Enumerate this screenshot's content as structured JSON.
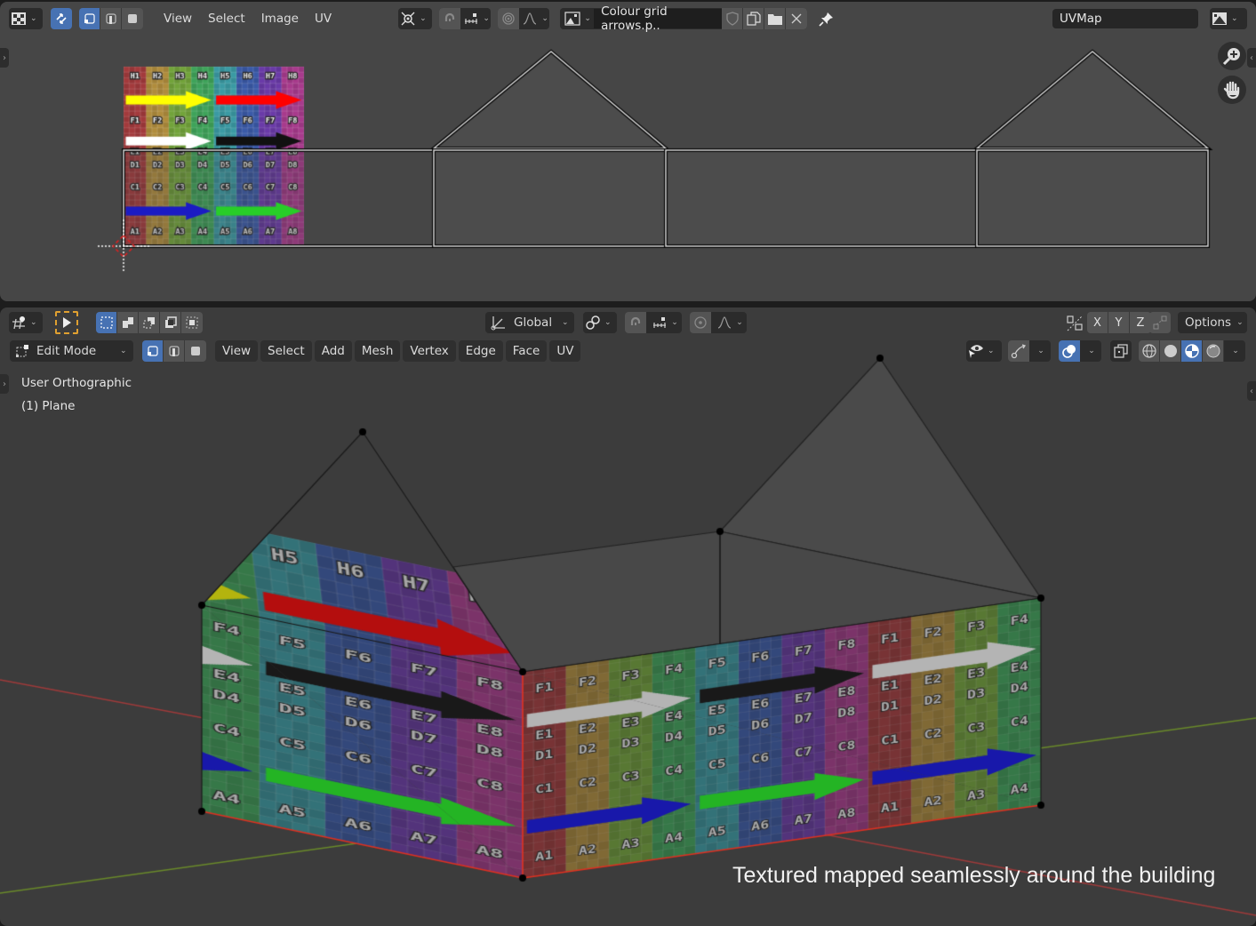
{
  "uv_editor": {
    "header": {
      "editor_type_icon": "uv-image-editor-icon",
      "sync_selection_icon": "uv-sync-selection-icon",
      "select_modes": [
        "vertex-select-icon",
        "edge-select-icon",
        "face-select-icon"
      ],
      "menus": [
        "View",
        "Select",
        "Image",
        "UV"
      ],
      "pivot_icon": "pivot-point-icon",
      "snap_icon": "snap-magnet-icon",
      "snap_increment_icon": "snap-increment-icon",
      "proportional_icon": "proportional-edit-icon",
      "falloff_icon": "falloff-curve-icon",
      "image_browse_icon": "image-browse-icon",
      "image_name": "Colour grid arrows.p..",
      "fake_user_icon": "shield-icon",
      "new_image_icon": "duplicate-icon",
      "open_image_icon": "folder-icon",
      "unlink_icon": "close-icon",
      "pin_icon": "pin-icon",
      "uv_map": "UVMap",
      "display_mode_icon": "image-display-icon"
    },
    "nav": {
      "zoom_icon": "zoom-in-icon",
      "pan_icon": "hand-pan-icon"
    },
    "texture": {
      "rows": [
        "H",
        "G",
        "F",
        "E",
        "D",
        "C",
        "B",
        "A"
      ],
      "columns": [
        "1",
        "2",
        "3",
        "4",
        "5",
        "6",
        "7",
        "8"
      ],
      "column_colors": [
        "#a33a3c",
        "#b08c3c",
        "#72a33a",
        "#3ea35a",
        "#3a9aa3",
        "#3a5aa8",
        "#6a3aa8",
        "#a83a8c"
      ],
      "arrows": [
        {
          "row": "G",
          "half": "left",
          "color": "#ffff00"
        },
        {
          "row": "G",
          "half": "right",
          "color": "#ff0000"
        },
        {
          "row": "E",
          "half": "left",
          "color": "#ffffff"
        },
        {
          "row": "E",
          "half": "right",
          "color": "#111111"
        },
        {
          "row": "B",
          "half": "left",
          "color": "#1010f0"
        },
        {
          "row": "B",
          "half": "right",
          "color": "#22ff22"
        }
      ]
    }
  },
  "viewport": {
    "tool_header": {
      "tool_settings_icon": "transform-tool-icon",
      "active_tool_icon": "select-cursor-icon",
      "select_mode_icons": [
        "select-new-icon",
        "select-extend-icon",
        "select-subtract-icon",
        "select-invert-icon",
        "select-intersect-icon"
      ],
      "orientation": "Global",
      "orientation_icon": "transform-orientation-icon",
      "pivot_icon": "pivot-link-icon",
      "snap_icon": "snap-magnet-icon",
      "snap_increment_icon": "snap-increment-icon",
      "proportional_icon": "proportional-edit-icon",
      "falloff_icon": "falloff-curve-icon",
      "mirror_icon": "mirror-axis-icon",
      "axes": [
        "X",
        "Y",
        "Z"
      ],
      "auto_merge_icon": "auto-merge-icon",
      "options_label": "Options"
    },
    "header": {
      "mode": "Edit Mode",
      "mode_icon": "edit-mode-icon",
      "select_modes": [
        "vertex-select-icon",
        "edge-select-icon",
        "face-select-icon"
      ],
      "menus": [
        "View",
        "Select",
        "Add",
        "Mesh",
        "Vertex",
        "Edge",
        "Face",
        "UV"
      ],
      "visibility_icon": "selectability-visibility-icon",
      "gizmo_icon": "gizmo-icon",
      "overlays_icon": "overlays-icon",
      "xray_icon": "xray-icon",
      "shading_icons": [
        "wireframe-shading-icon",
        "solid-shading-icon",
        "material-preview-icon",
        "rendered-shading-icon"
      ]
    },
    "overlay": {
      "view_name": "User Orthographic",
      "object_name": "(1) Plane"
    },
    "caption": "Textured mapped seamlessly around the building"
  },
  "colors": {
    "accent": "#4772b3",
    "background_uv": "#464646",
    "background_3d": "#3c3c3c",
    "x_axis": "#a03a3a",
    "y_axis": "#6a8a2a",
    "seam": "#e03020",
    "active_tool_outline": "#e0a030"
  }
}
